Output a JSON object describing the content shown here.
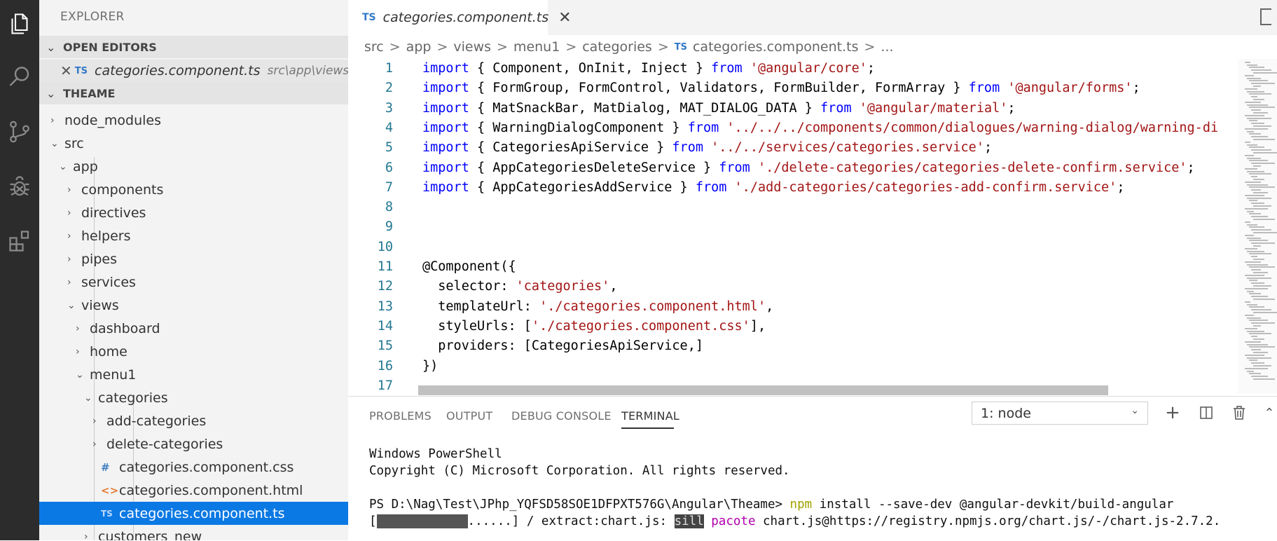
{
  "sidebar": {
    "title": "EXPLORER",
    "open_editors_label": "OPEN EDITORS",
    "open_editor": {
      "close": "✕",
      "badge": "TS",
      "name": "categories.component.ts",
      "path": "src\\app\\views\\m..."
    },
    "workspace_label": "THEAME",
    "tree": [
      {
        "label": "node_modules",
        "chev": "›",
        "icon": ""
      },
      {
        "label": "src",
        "chev": "⌄",
        "icon": ""
      },
      {
        "label": "app",
        "chev": "⌄",
        "icon": ""
      },
      {
        "label": "components",
        "chev": "›",
        "icon": ""
      },
      {
        "label": "directives",
        "chev": "›",
        "icon": ""
      },
      {
        "label": "helpers",
        "chev": "›",
        "icon": ""
      },
      {
        "label": "pipes",
        "chev": "›",
        "icon": ""
      },
      {
        "label": "services",
        "chev": "›",
        "icon": ""
      },
      {
        "label": "views",
        "chev": "⌄",
        "icon": ""
      },
      {
        "label": "dashboard",
        "chev": "›",
        "icon": ""
      },
      {
        "label": "home",
        "chev": "›",
        "icon": ""
      },
      {
        "label": "menu1",
        "chev": "⌄",
        "icon": ""
      },
      {
        "label": "categories",
        "chev": "⌄",
        "icon": ""
      },
      {
        "label": "add-categories",
        "chev": "›",
        "icon": ""
      },
      {
        "label": "delete-categories",
        "chev": "›",
        "icon": ""
      },
      {
        "label": "categories.component.css",
        "chev": "",
        "icon": "#"
      },
      {
        "label": "categories.component.html",
        "chev": "",
        "icon": "<>"
      },
      {
        "label": "categories.component.ts",
        "chev": "",
        "icon": "TS"
      },
      {
        "label": "customers_new",
        "chev": "›",
        "icon": ""
      }
    ]
  },
  "editor": {
    "tab": {
      "badge": "TS",
      "name": "categories.component.ts",
      "close": "✕"
    },
    "breadcrumb": {
      "parts": [
        "src",
        "app",
        "views",
        "menu1",
        "categories"
      ],
      "sep": ">",
      "file_badge": "TS",
      "file": "categories.component.ts",
      "tail": "..."
    },
    "lines": [
      {
        "n": "1",
        "segs": [
          [
            "kw",
            "import"
          ],
          [
            "plain",
            " { Component, OnInit, Inject } "
          ],
          [
            "kw",
            "from"
          ],
          [
            "plain",
            " "
          ],
          [
            "str",
            "'@angular/core'"
          ],
          [
            "plain",
            ";"
          ]
        ]
      },
      {
        "n": "2",
        "segs": [
          [
            "kw",
            "import"
          ],
          [
            "plain",
            " { FormGroup, FormControl, Validators, FormBuilder, FormArray } "
          ],
          [
            "kw",
            "from"
          ],
          [
            "plain",
            " "
          ],
          [
            "str",
            "'@angular/forms'"
          ],
          [
            "plain",
            ";"
          ]
        ]
      },
      {
        "n": "3",
        "segs": [
          [
            "kw",
            "import"
          ],
          [
            "plain",
            " { MatSnackBar, MatDialog, MAT_DIALOG_DATA } "
          ],
          [
            "kw",
            "from"
          ],
          [
            "plain",
            " "
          ],
          [
            "str",
            "'@angular/material'"
          ],
          [
            "plain",
            ";"
          ]
        ]
      },
      {
        "n": "4",
        "segs": [
          [
            "kw",
            "import"
          ],
          [
            "plain",
            " { WarningDialogComponent } "
          ],
          [
            "kw",
            "from"
          ],
          [
            "plain",
            " "
          ],
          [
            "str",
            "'../../../components/common/dialogues/warning-dialog/warning-di"
          ]
        ]
      },
      {
        "n": "5",
        "segs": [
          [
            "kw",
            "import"
          ],
          [
            "plain",
            " { CategoriesApiService } "
          ],
          [
            "kw",
            "from"
          ],
          [
            "plain",
            " "
          ],
          [
            "str",
            "'../../services/categories.service'"
          ],
          [
            "plain",
            ";"
          ]
        ]
      },
      {
        "n": "6",
        "segs": [
          [
            "kw",
            "import"
          ],
          [
            "plain",
            " { AppCategoriesDeleteService } "
          ],
          [
            "kw",
            "from"
          ],
          [
            "plain",
            " "
          ],
          [
            "str",
            "'./delete-categories/categories-delete-confirm.service'"
          ],
          [
            "plain",
            ";"
          ]
        ]
      },
      {
        "n": "7",
        "segs": [
          [
            "kw",
            "import"
          ],
          [
            "plain",
            " { AppCategoriesAddService } "
          ],
          [
            "kw",
            "from"
          ],
          [
            "plain",
            " "
          ],
          [
            "str",
            "'./add-categories/categories-add-confirm.service'"
          ],
          [
            "plain",
            ";"
          ]
        ]
      },
      {
        "n": "8",
        "segs": []
      },
      {
        "n": "9",
        "segs": []
      },
      {
        "n": "10",
        "segs": []
      },
      {
        "n": "11",
        "segs": [
          [
            "plain",
            "@Component({"
          ]
        ]
      },
      {
        "n": "12",
        "segs": [
          [
            "plain",
            "  selector: "
          ],
          [
            "str",
            "'categories'"
          ],
          [
            "plain",
            ","
          ]
        ]
      },
      {
        "n": "13",
        "segs": [
          [
            "plain",
            "  templateUrl: "
          ],
          [
            "str",
            "'./categories.component.html'"
          ],
          [
            "plain",
            ","
          ]
        ]
      },
      {
        "n": "14",
        "segs": [
          [
            "plain",
            "  styleUrls: ["
          ],
          [
            "str",
            "'./categories.component.css'"
          ],
          [
            "plain",
            "],"
          ]
        ]
      },
      {
        "n": "15",
        "segs": [
          [
            "plain",
            "  providers: [CategoriesApiService,]"
          ]
        ]
      },
      {
        "n": "16",
        "segs": [
          [
            "plain",
            "})"
          ]
        ]
      },
      {
        "n": "17",
        "segs": []
      }
    ]
  },
  "panel": {
    "tabs": [
      "PROBLEMS",
      "OUTPUT",
      "DEBUG CONSOLE",
      "TERMINAL"
    ],
    "active_tab": "TERMINAL",
    "terminal_select": "1: node",
    "buttons": {
      "add": "+",
      "split": "◫",
      "trash": "🗑",
      "collapse": "⌃"
    },
    "terminal": {
      "line1": "Windows PowerShell",
      "line2": "Copyright (C) Microsoft Corporation. All rights reserved.",
      "prompt": "PS D:\\Nag\\Test\\JPhp_YQFSD58SOE1DFPXT576G\\Angular\\Theame> ",
      "cmd_npm": "npm",
      "cmd_rest": " install --save-dev @angular-devkit/build-angular",
      "prog_open": "[",
      "prog_dots": "......] / extract:chart.js: ",
      "sill": "sill",
      "pacote": "pacote",
      "prog_rest": " chart.js@https://registry.npmjs.org/chart.js/-/chart.js-2.7.2."
    }
  }
}
